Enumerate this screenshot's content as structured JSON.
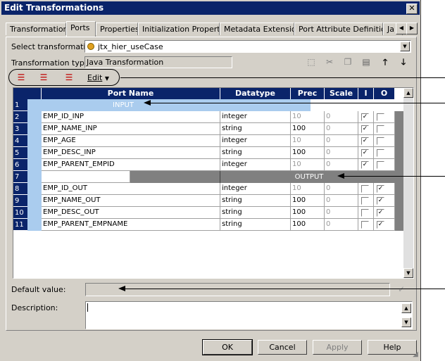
{
  "window": {
    "title": "Edit Transformations",
    "close_glyph": "✕"
  },
  "tabs": [
    {
      "label": "Transformation",
      "active": false
    },
    {
      "label": "Ports",
      "active": true
    },
    {
      "label": "Properties",
      "active": false
    },
    {
      "label": "Initialization Properties",
      "active": false
    },
    {
      "label": "Metadata Extensions",
      "active": false
    },
    {
      "label": "Port Attribute Definitions",
      "active": false
    },
    {
      "label": "Ja",
      "active": false
    }
  ],
  "form": {
    "select_label": "Select transformation:",
    "select_value": "jtx_hier_useCase",
    "type_label": "Transformation type:",
    "type_value": "Java Transformation",
    "edit_menu": "Edit",
    "default_value_label": "Default value:",
    "description_label": "Description:"
  },
  "grid": {
    "headers": [
      "Port Name",
      "Datatype",
      "Prec",
      "Scale",
      "I",
      "O"
    ],
    "input_label": "INPUT",
    "output_label": "OUTPUT",
    "rows": [
      {
        "num": "1",
        "section": "input"
      },
      {
        "num": "2",
        "name": "EMP_ID_INP",
        "type": "integer",
        "prec": "10",
        "scale": "0",
        "i": true,
        "o": false,
        "prec_gray": true
      },
      {
        "num": "3",
        "name": "EMP_NAME_INP",
        "type": "string",
        "prec": "100",
        "scale": "0",
        "i": true,
        "o": false,
        "prec_gray": false
      },
      {
        "num": "4",
        "name": "EMP_AGE",
        "type": "integer",
        "prec": "10",
        "scale": "0",
        "i": true,
        "o": false,
        "prec_gray": true
      },
      {
        "num": "5",
        "name": "EMP_DESC_INP",
        "type": "string",
        "prec": "100",
        "scale": "0",
        "i": true,
        "o": false,
        "prec_gray": false
      },
      {
        "num": "6",
        "name": "EMP_PARENT_EMPID",
        "type": "integer",
        "prec": "10",
        "scale": "0",
        "i": true,
        "o": false,
        "prec_gray": true
      },
      {
        "num": "7",
        "section": "output"
      },
      {
        "num": "8",
        "name": "EMP_ID_OUT",
        "type": "integer",
        "prec": "10",
        "scale": "0",
        "i": false,
        "o": true,
        "prec_gray": true
      },
      {
        "num": "9",
        "name": "EMP_NAME_OUT",
        "type": "string",
        "prec": "100",
        "scale": "0",
        "i": false,
        "o": true,
        "prec_gray": false
      },
      {
        "num": "10",
        "name": "EMP_DESC_OUT",
        "type": "string",
        "prec": "100",
        "scale": "0",
        "i": false,
        "o": true,
        "prec_gray": false
      },
      {
        "num": "11",
        "name": "EMP_PARENT_EMPNAME",
        "type": "string",
        "prec": "100",
        "scale": "0",
        "i": false,
        "o": true,
        "prec_gray": false
      }
    ]
  },
  "buttons": {
    "ok": "OK",
    "cancel": "Cancel",
    "apply": "Apply",
    "help": "Help"
  },
  "colors": {
    "title_bar": "#0a246a",
    "header": "#0a246a",
    "dialog": "#d4d0c8",
    "input_band": "#aaccee"
  }
}
